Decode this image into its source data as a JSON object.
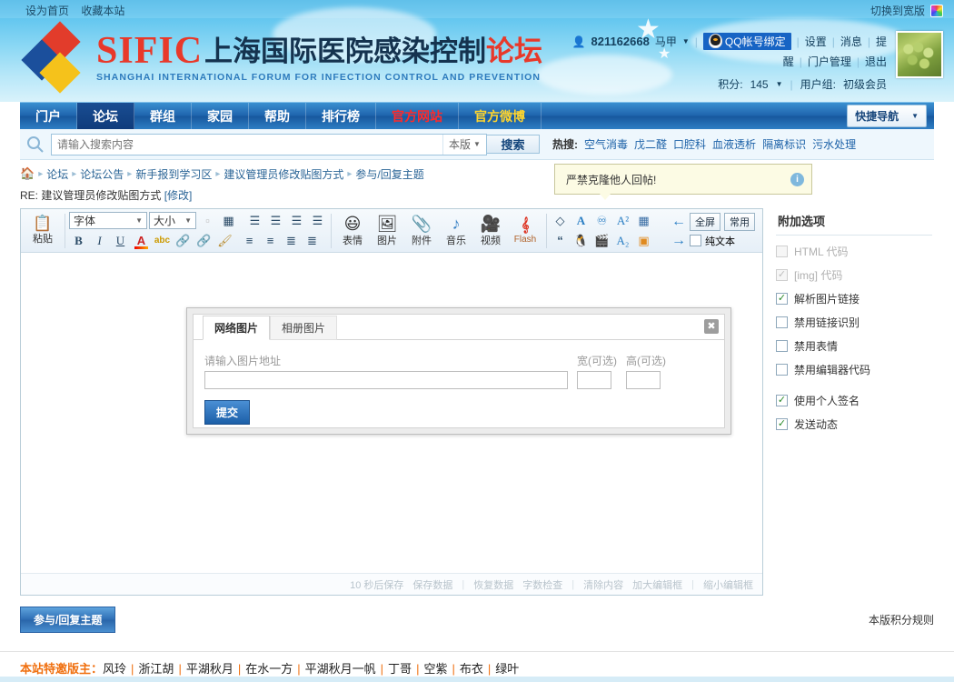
{
  "topbar": {
    "set_homepage": "设为首页",
    "bookmark": "收藏本站",
    "switch_wide": "切换到宽版",
    "theme_icon": "rainbow-square-icon"
  },
  "logo": {
    "brand": "SIFIC",
    "cn_title_main": "上海国际医院感染控制",
    "cn_title_accent": "论坛",
    "en_title": "SHANGHAI INTERNATIONAL FORUM FOR INFECTION CONTROL AND PREVENTION"
  },
  "user": {
    "uid": "821162668",
    "alias": "马甲",
    "qq_bind": "QQ帐号绑定",
    "links_row1": [
      "设置",
      "消息",
      "提"
    ],
    "links_row2": [
      "醒",
      "门户管理",
      "退出"
    ],
    "points_label": "积分:",
    "points_value": "145",
    "group_label": "用户组:",
    "group_value": "初级会员"
  },
  "nav": {
    "items": [
      {
        "label": "门户",
        "state": "normal"
      },
      {
        "label": "论坛",
        "state": "active"
      },
      {
        "label": "群组",
        "state": "normal"
      },
      {
        "label": "家园",
        "state": "normal"
      },
      {
        "label": "帮助",
        "state": "normal"
      },
      {
        "label": "排行榜",
        "state": "normal"
      },
      {
        "label": "官方网站",
        "state": "red"
      },
      {
        "label": "官方微博",
        "state": "yellow"
      }
    ],
    "quick_nav": "快捷导航"
  },
  "search": {
    "placeholder": "请输入搜索内容",
    "scope": "本版",
    "button": "搜索",
    "hot_label": "热搜:",
    "hot_keywords": [
      "空气消毒",
      "戊二醛",
      "口腔科",
      "血液透析",
      "隔离标识",
      "污水处理"
    ]
  },
  "breadcrumb": {
    "home_icon": "home-icon",
    "items": [
      "论坛",
      "论坛公告",
      "新手报到学习区",
      "建议管理员修改贴图方式",
      "参与/回复主题"
    ]
  },
  "page_title": {
    "prefix": "RE: 建议管理员修改贴图方式",
    "edit": "[修改]"
  },
  "tooltip": {
    "text": "严禁克隆他人回帖!",
    "help_icon": "question-icon"
  },
  "toolbar": {
    "paste_label": "粘贴",
    "font_select": "字体",
    "size_select": "大小",
    "row1_icons": [
      "table-icon",
      "align-left-icon",
      "align-center-icon",
      "align-right-icon",
      "align-justify-icon"
    ],
    "row2_icons": [
      "bold-icon",
      "italic-icon",
      "underline-icon",
      "font-color-icon",
      "spellcheck-icon",
      "insert-link-icon",
      "remove-link-icon",
      "format-painter-icon",
      "outdent-icon",
      "indent-icon",
      "ordered-list-icon",
      "unordered-list-icon"
    ],
    "media_buttons": [
      {
        "label": "表情",
        "icon": "smiley-icon"
      },
      {
        "label": "图片",
        "icon": "image-icon"
      },
      {
        "label": "附件",
        "icon": "paperclip-icon"
      },
      {
        "label": "音乐",
        "icon": "music-note-icon"
      },
      {
        "label": "视频",
        "icon": "video-icon"
      },
      {
        "label": "Flash",
        "icon": "flash-icon"
      }
    ],
    "extra_row1": [
      "code-icon",
      "bold-a-icon",
      "crossout-icon",
      "superscript-icon",
      "word-icon"
    ],
    "extra_row2": [
      "quote-icon",
      "qq-icon",
      "media-icon",
      "subscript-icon",
      "book-icon"
    ],
    "fullscreen": "全屏",
    "common": "常用",
    "plaintext": "纯文本",
    "undo_icon": "undo-arrow-icon",
    "redo_icon": "redo-arrow-icon"
  },
  "dialog": {
    "tab_network": "网络图片",
    "tab_album": "相册图片",
    "url_label": "请输入图片地址",
    "url_value": "",
    "width_label": "宽(可选)",
    "width_value": "",
    "height_label": "高(可选)",
    "height_value": "",
    "submit": "提交",
    "close_icon": "close-icon"
  },
  "editor_footer": {
    "autosave": "10 秒后保存",
    "save_data": "保存数据",
    "restore_data": "恢复数据",
    "word_count": "字数检查",
    "clear": "清除内容",
    "enlarge": "加大编辑框",
    "shrink": "缩小编辑框"
  },
  "sidebar": {
    "title": "附加选项",
    "options": [
      {
        "label": "HTML 代码",
        "checked": false,
        "disabled": true
      },
      {
        "label": "[img] 代码",
        "checked": true,
        "disabled": true
      },
      {
        "label": "解析图片链接",
        "checked": true,
        "disabled": false
      },
      {
        "label": "禁用链接识别",
        "checked": false,
        "disabled": false
      },
      {
        "label": "禁用表情",
        "checked": false,
        "disabled": false
      },
      {
        "label": "禁用编辑器代码",
        "checked": false,
        "disabled": false
      },
      {
        "label": "使用个人签名",
        "checked": true,
        "disabled": false,
        "spaced": true
      },
      {
        "label": "发送动态",
        "checked": true,
        "disabled": false
      }
    ]
  },
  "bottom": {
    "reply_button": "参与/回复主题",
    "rule_link": "本版积分规则"
  },
  "footer": {
    "title": "本站特邀版主：",
    "moderators": [
      "风玲",
      "浙江胡",
      "平湖秋月",
      "在水一方",
      "平湖秋月一帆",
      "丁哥",
      "空紫",
      "布衣",
      "绿叶"
    ]
  }
}
